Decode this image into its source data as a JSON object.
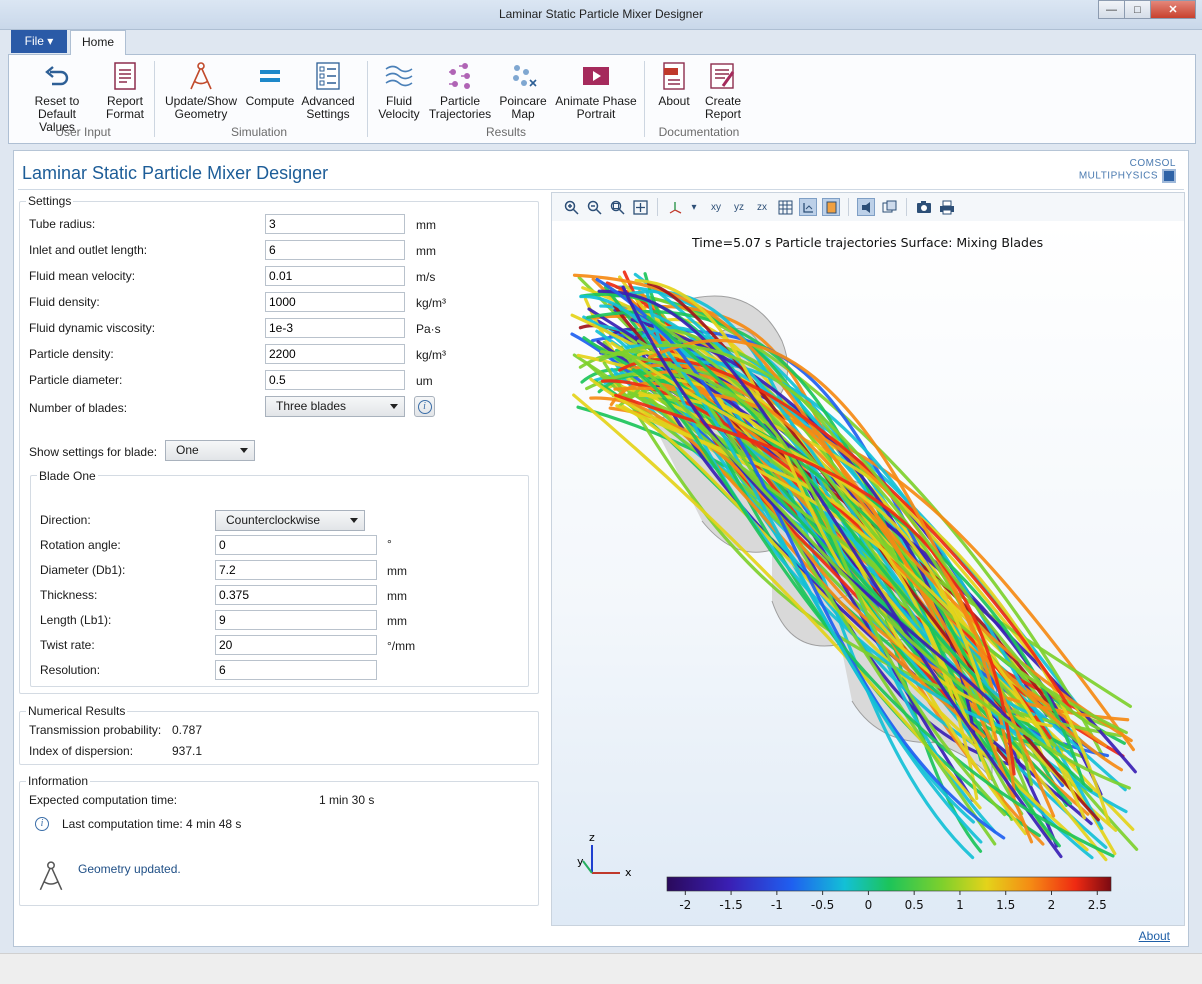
{
  "window": {
    "title": "Laminar Static Particle Mixer Designer",
    "buttons": {
      "minimize": "—",
      "maximize": "□",
      "close": "✕"
    }
  },
  "ribbon": {
    "file_tab": "File ▾",
    "home_tab": "Home",
    "groups": {
      "user_input": {
        "name": "User Input",
        "reset": "Reset to\nDefault Values",
        "report": "Report\nFormat"
      },
      "simulation": {
        "name": "Simulation",
        "geometry": "Update/Show\nGeometry",
        "compute": "Compute",
        "advanced": "Advanced\nSettings"
      },
      "results": {
        "name": "Results",
        "fluid": "Fluid\nVelocity",
        "particle": "Particle\nTrajectories",
        "poincare": "Poincare\nMap",
        "animate": "Animate Phase\nPortrait"
      },
      "documentation": {
        "name": "Documentation",
        "about": "About",
        "create": "Create\nReport"
      }
    }
  },
  "app": {
    "title": "Laminar Static Particle Mixer Designer",
    "logo": {
      "line1": "COMSOL",
      "line2": "MULTIPHYSICS"
    },
    "about_link": "About"
  },
  "settings": {
    "legend": "Settings",
    "rows": [
      {
        "label": "Tube radius:",
        "value": "3",
        "unit": "mm"
      },
      {
        "label": "Inlet and outlet length:",
        "value": "6",
        "unit": "mm"
      },
      {
        "label": "Fluid mean velocity:",
        "value": "0.01",
        "unit": "m/s"
      },
      {
        "label": "Fluid density:",
        "value": "1000",
        "unit": "kg/m³"
      },
      {
        "label": "Fluid dynamic viscosity:",
        "value": "1e-3",
        "unit": "Pa·s"
      },
      {
        "label": "Particle density:",
        "value": "2200",
        "unit": "kg/m³"
      },
      {
        "label": "Particle diameter:",
        "value": "0.5",
        "unit": "um"
      }
    ],
    "blades_label": "Number of blades:",
    "blades_value": "Three blades",
    "show_blade_label": "Show settings for blade:",
    "show_blade_value": "One"
  },
  "blade": {
    "legend": "Blade One",
    "direction_label": "Direction:",
    "direction_value": "Counterclockwise",
    "rows": [
      {
        "label": "Rotation angle:",
        "value": "0",
        "unit": "°"
      },
      {
        "label": "Diameter (Db1):",
        "value": "7.2",
        "unit": "mm"
      },
      {
        "label": "Thickness:",
        "value": "0.375",
        "unit": "mm"
      },
      {
        "label": "Length (Lb1):",
        "value": "9",
        "unit": "mm"
      },
      {
        "label": "Twist rate:",
        "value": "20",
        "unit": "°/mm"
      },
      {
        "label": "Resolution:",
        "value": "6",
        "unit": ""
      }
    ]
  },
  "numerical": {
    "legend": "Numerical Results",
    "transmission_label": "Transmission probability:",
    "transmission_value": "0.787",
    "dispersion_label": "Index of dispersion:",
    "dispersion_value": "937.1"
  },
  "information": {
    "legend": "Information",
    "expected_label": "Expected computation time:",
    "expected_value": "1 min 30 s",
    "last": "Last computation time: 4 min 48 s",
    "status": "Geometry updated."
  },
  "plot": {
    "title": "Time=5.07 s Particle trajectories Surface: Mixing Blades",
    "axes": {
      "x": "x",
      "y": "y",
      "z": "z"
    },
    "colorbar_ticks": [
      "-2",
      "-1.5",
      "-1",
      "-0.5",
      "0",
      "0.5",
      "1",
      "1.5",
      "2",
      "2.5"
    ],
    "colorbar_range": [
      -2.2,
      2.65
    ],
    "colors": {
      "blade": "#d8d8d8",
      "accent": "#1f5fa7"
    }
  }
}
